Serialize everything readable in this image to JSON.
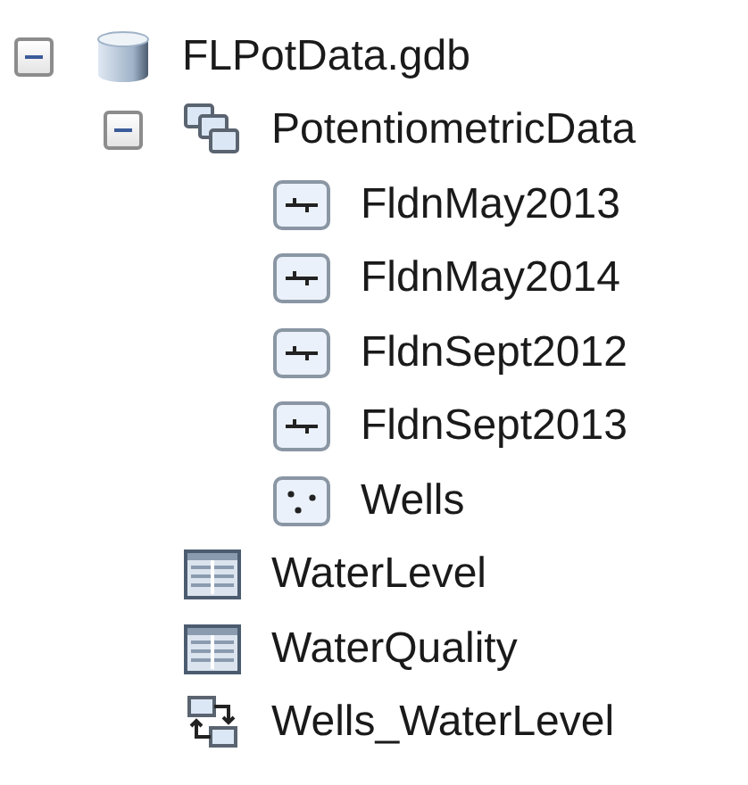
{
  "tree": [
    {
      "kind": "database",
      "label": "FLPotData.gdb",
      "expanded": true,
      "children": [
        {
          "kind": "dataset",
          "label": "PotentiometricData",
          "expanded": true,
          "children": [
            {
              "kind": "line",
              "label": "FldnMay2013"
            },
            {
              "kind": "line",
              "label": "FldnMay2014"
            },
            {
              "kind": "line",
              "label": "FldnSept2012"
            },
            {
              "kind": "line",
              "label": "FldnSept2013"
            },
            {
              "kind": "point",
              "label": "Wells"
            }
          ]
        },
        {
          "kind": "table",
          "label": "WaterLevel"
        },
        {
          "kind": "table",
          "label": "WaterQuality"
        },
        {
          "kind": "relationship",
          "label": "Wells_WaterLevel"
        }
      ]
    }
  ]
}
